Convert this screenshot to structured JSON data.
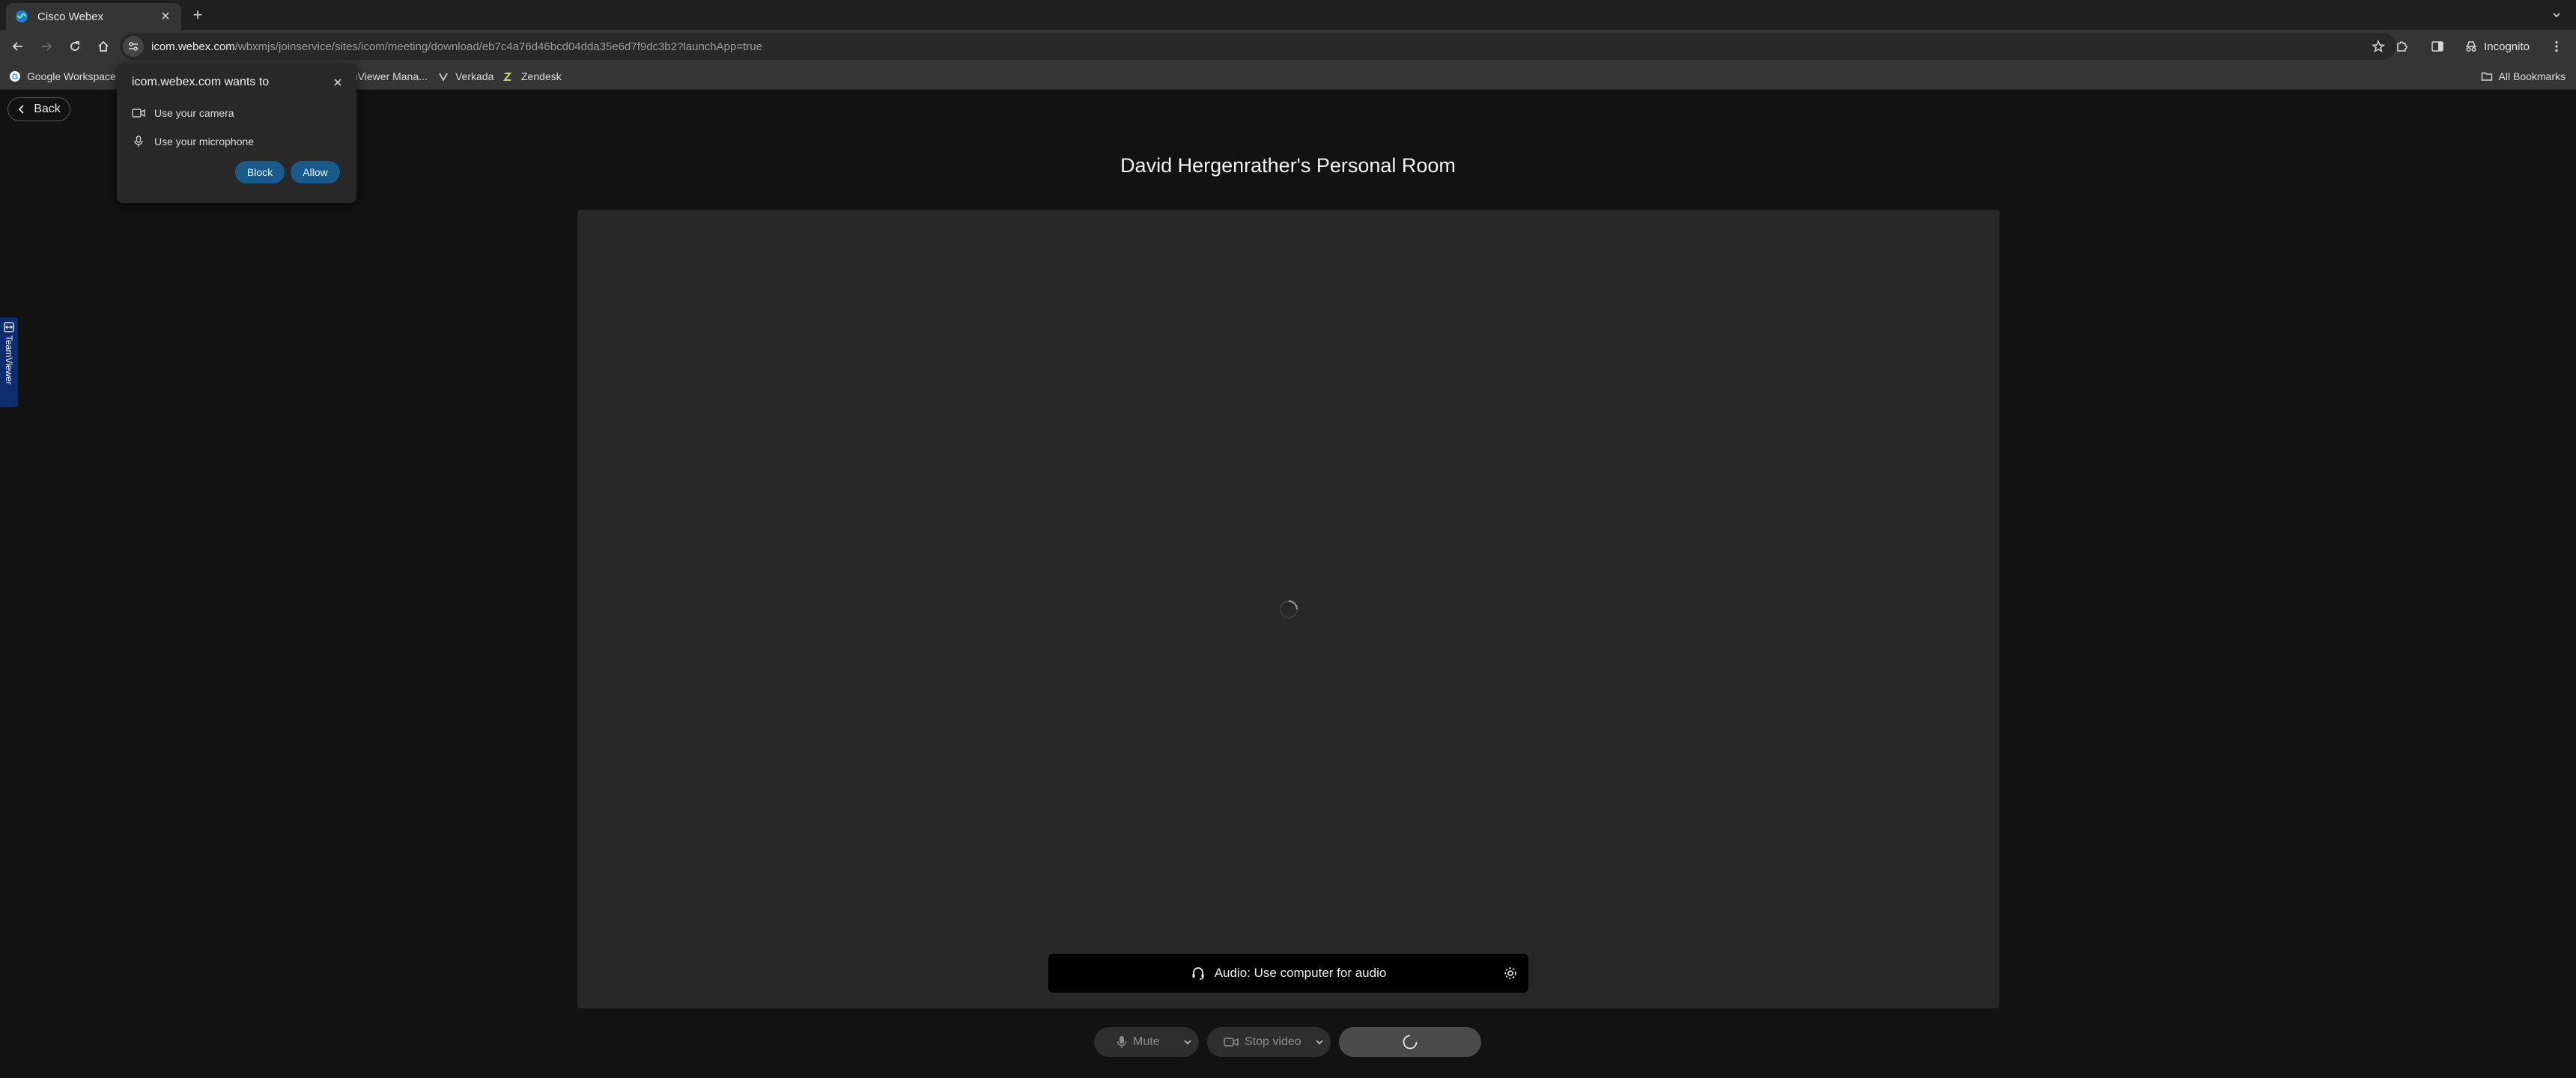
{
  "browser": {
    "tab": {
      "title": "Cisco Webex",
      "favicon": "webex-icon"
    },
    "url": {
      "host": "icom.webex.com",
      "path": "/wbxmjs/joinservice/sites/icom/meeting/download/eb7c4a76d46bcd04dda35e6d7f9dc3b2?launchApp=true"
    },
    "profile_label": "Incognito",
    "bookmarks": [
      {
        "label": "Google Workspace",
        "icon": "google-icon"
      },
      {
        "label": "mViewer Mana...",
        "icon": "teamviewer-icon"
      },
      {
        "label": "Verkada",
        "icon": "verkada-icon"
      },
      {
        "label": "Zendesk",
        "icon": "zendesk-icon"
      }
    ],
    "all_bookmarks_label": "All Bookmarks"
  },
  "permission_prompt": {
    "title": "icom.webex.com wants to",
    "items": [
      {
        "label": "Use your camera",
        "icon": "camera-icon"
      },
      {
        "label": "Use your microphone",
        "icon": "microphone-icon"
      }
    ],
    "block_label": "Block",
    "allow_label": "Allow"
  },
  "page": {
    "back_label": "Back",
    "room_title": "David Hergenrather's Personal Room",
    "audio": {
      "label": "Audio: Use computer for audio"
    },
    "controls": {
      "mute_label": "Mute",
      "video_label": "Stop video"
    },
    "sidebar_tab_label": "TeamViewer"
  }
}
